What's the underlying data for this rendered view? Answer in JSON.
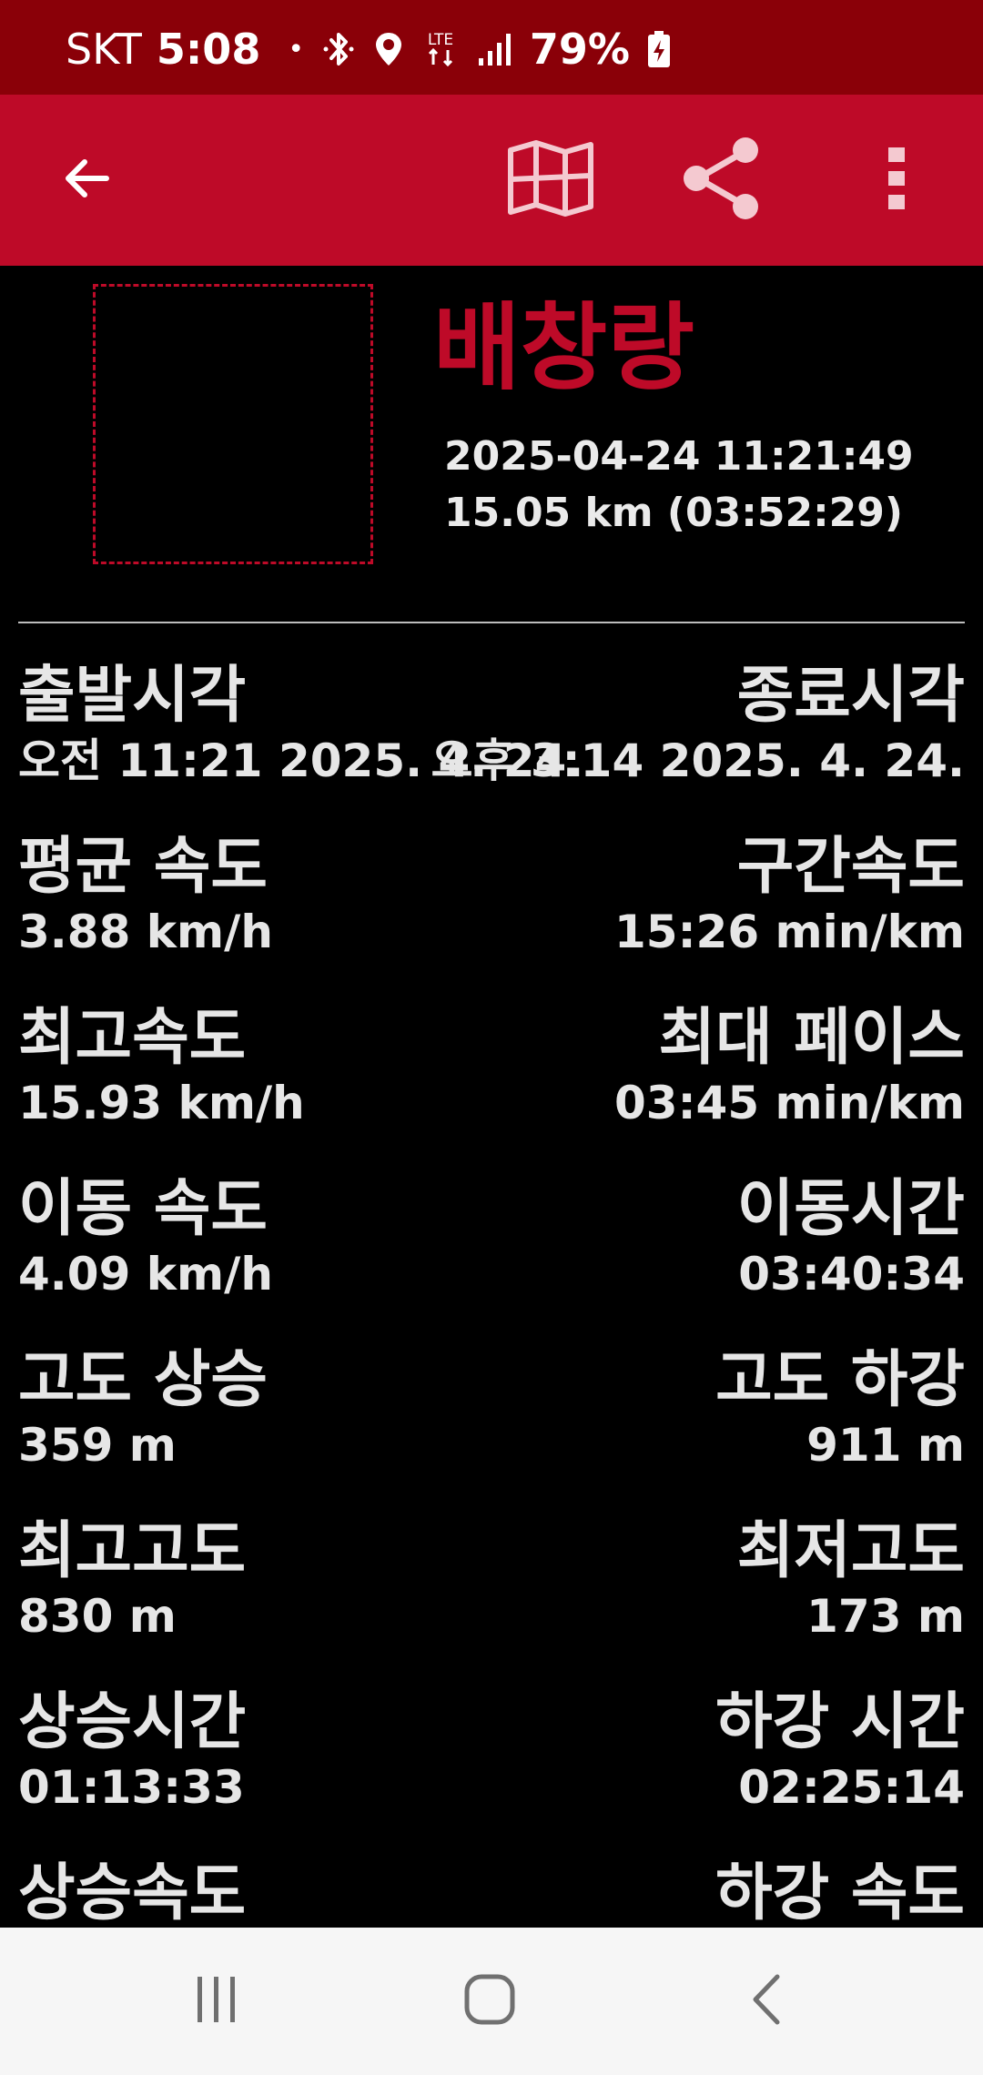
{
  "status_bar": {
    "carrier": "SKT",
    "time": "5:08",
    "notification_dot": "•",
    "network": "LTE",
    "battery": "79%",
    "icons": [
      "bluetooth-icon",
      "location-icon",
      "lte-icon",
      "signal-icon",
      "battery-charging-icon"
    ]
  },
  "toolbar": {
    "back_icon": "arrow-back-icon",
    "map_icon": "map-icon",
    "share_icon": "share-icon",
    "more_icon": "more-vertical-icon",
    "background_color": "#be0a28"
  },
  "header": {
    "title": "배창랑",
    "date": "2025-04-24 11:21:49",
    "summary": "15.05 km (03:52:29)",
    "title_color": "#be0a28"
  },
  "stats": [
    {
      "left": {
        "label": "출발시각",
        "value": "오전 11:21 2025. 4. 24."
      },
      "right": {
        "label": "종료시각",
        "value": "오후 3:14 2025. 4. 24."
      }
    },
    {
      "left": {
        "label": "평균 속도",
        "value": "3.88 km/h"
      },
      "right": {
        "label": "구간속도",
        "value": "15:26 min/km"
      }
    },
    {
      "left": {
        "label": "최고속도",
        "value": "15.93 km/h"
      },
      "right": {
        "label": "최대 페이스",
        "value": "03:45 min/km"
      }
    },
    {
      "left": {
        "label": "이동 속도",
        "value": "4.09 km/h"
      },
      "right": {
        "label": "이동시간",
        "value": "03:40:34"
      }
    },
    {
      "left": {
        "label": "고도 상승",
        "value": "359 m"
      },
      "right": {
        "label": "고도 하강",
        "value": "911 m"
      }
    },
    {
      "left": {
        "label": "최고고도",
        "value": "830 m"
      },
      "right": {
        "label": "최저고도",
        "value": "173 m"
      }
    },
    {
      "left": {
        "label": "상승시간",
        "value": "01:13:33"
      },
      "right": {
        "label": "하강 시간",
        "value": "02:25:14"
      }
    },
    {
      "left": {
        "label": "상승속도",
        "value": ""
      },
      "right": {
        "label": "하강 속도",
        "value": ""
      }
    }
  ],
  "nav_bar": {
    "recents_icon": "recents-icon",
    "home_icon": "home-icon",
    "back_icon": "nav-back-icon"
  }
}
